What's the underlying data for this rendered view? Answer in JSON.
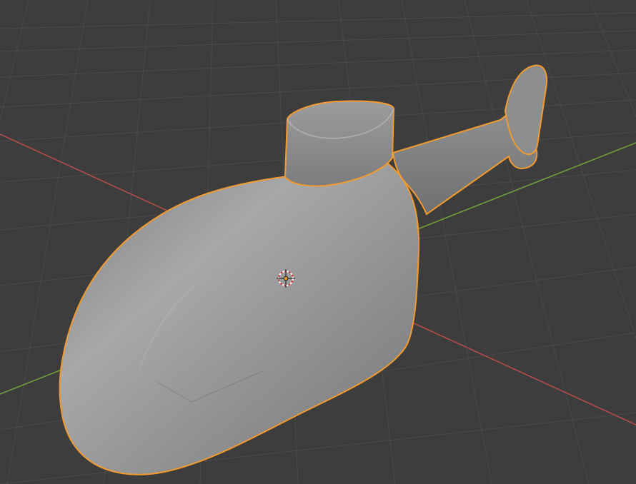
{
  "viewport": {
    "background": "#3d3d3d",
    "grid_color": "#4a4a4a",
    "x_axis_color": "#b54a4a",
    "y_axis_color": "#6f9f3a"
  },
  "selected_object": {
    "type": "mesh",
    "description_icon": "helicopter-body",
    "fill": "#8f9090",
    "outline": "#f29a2f"
  },
  "cursor": {
    "icon": "3d-cursor-icon",
    "ring_colors": [
      "#ffffff",
      "#d53a3a"
    ],
    "center_color": "#f29a2f"
  }
}
